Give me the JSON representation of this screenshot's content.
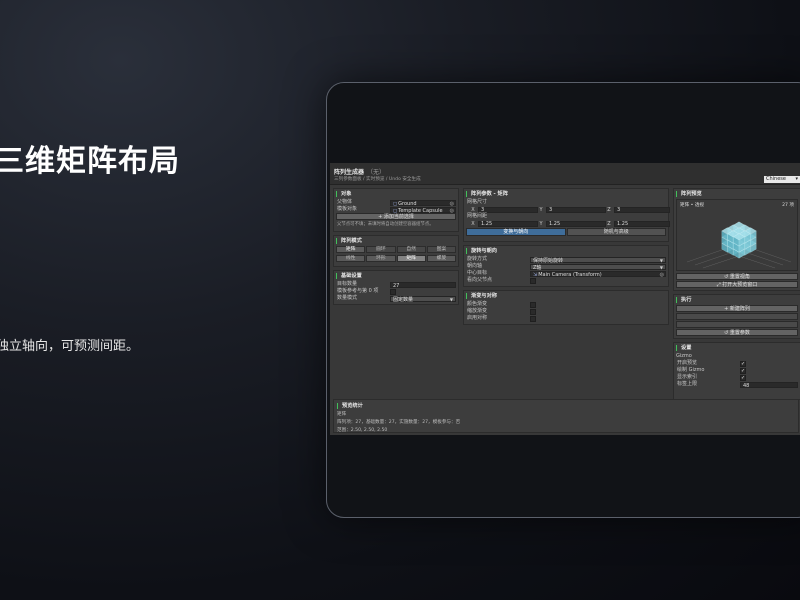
{
  "slide": {
    "title": "三维矩阵布局",
    "description": "独立轴向，可预测间距。"
  },
  "app": {
    "title": "阵列生成器",
    "title_suffix": "（无）",
    "subtitle": "三列参数面板 / 实时预览 / Undo 安全生成",
    "language": "Chinese"
  },
  "object_panel": {
    "header": "对象",
    "parent_label": "父物体",
    "parent_value": "Ground",
    "template_label": "模板对象",
    "template_value": "Template Capsule",
    "add_button": "+ 添加当前选择",
    "note": "父节点可不填；未填时将自动创建空容器组节点。"
  },
  "mode_panel": {
    "header": "阵列模式",
    "modes": [
      "矩阵",
      "圆环",
      "自然",
      "图案"
    ],
    "active_mode": 0,
    "submodes": [
      "线性",
      "环形",
      "矩阵",
      "螺旋"
    ],
    "active_submode": 2
  },
  "basic_panel": {
    "header": "基础设置",
    "count_label": "目标数量",
    "count_value": "27",
    "template_ref_label": "模板参考与第 0 项",
    "quantity_mode_label": "数量模式",
    "quantity_mode_value": "固定数量"
  },
  "array_params": {
    "header": "阵列参数 - 矩阵",
    "grid_size_label": "网格尺寸",
    "grid_size": {
      "x": "3",
      "y": "3",
      "z": "3"
    },
    "spacing_label": "网格间距",
    "spacing": {
      "x": "1.25",
      "y": "1.25",
      "z": "1.25"
    },
    "tabs": [
      "变换与朝向",
      "随机与高级"
    ],
    "active_tab": 0
  },
  "rotation_panel": {
    "header": "旋转与朝向",
    "rotation_mode_label": "旋转方式",
    "rotation_mode_value": "保持原始旋转",
    "axis_label": "朝向轴",
    "axis_value": "Z轴",
    "center_label": "中心目标",
    "center_value": "Main Camera (Transform)",
    "face_parent_label": "看向父节点"
  },
  "gradient_panel": {
    "header": "渐变与对称",
    "color_grad_label": "颜色渐变",
    "scale_grad_label": "缩放渐变",
    "symmetry_label": "启用对称"
  },
  "preview_panel": {
    "header": "阵列预览",
    "preview_title": "矩阵 • 透视",
    "preview_count": "27 项",
    "reset_view": "↺ 重置视角",
    "open_large": "⤢ 打开大预览窗口"
  },
  "execute_panel": {
    "header": "执行",
    "new_array": "+ 新建阵列",
    "reset_params": "↺ 重置参数"
  },
  "settings_panel": {
    "header": "设置",
    "gizmo_label": "Gizmo",
    "enable_preview": "开启预览",
    "draw_gizmo": "绘制 Gizmo",
    "show_index": "显示索引",
    "label_limit": "标签上限",
    "label_limit_value": "48"
  },
  "stats": {
    "header": "预览统计",
    "mode": "矩阵",
    "line1": "阵列项：27，基础数量：27，实施数量：27，模板参与：否",
    "line2": "范围：2.50, 2.50, 2.50"
  }
}
